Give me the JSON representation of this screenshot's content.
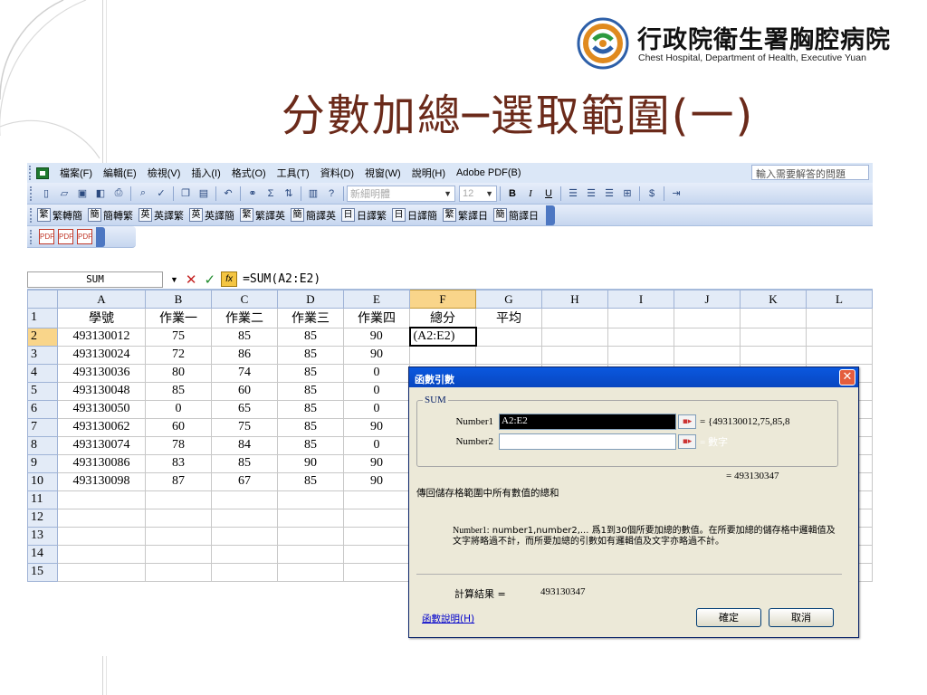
{
  "logo": {
    "name_cn": "行政院衛生署胸腔病院",
    "name_en": "Chest Hospital, Department of Health, Executive Yuan"
  },
  "slide_title": "分數加總─選取範圍(一)",
  "menu": [
    "檔案(F)",
    "編輯(E)",
    "檢視(V)",
    "插入(I)",
    "格式(O)",
    "工具(T)",
    "資料(D)",
    "視窗(W)",
    "說明(H)",
    "Adobe PDF(B)"
  ],
  "help_placeholder": "輸入需要解答的問題",
  "toolbar": {
    "font_name": "新細明體",
    "font_size": "12",
    "bold": "B",
    "italic": "I",
    "underline": "U",
    "currency": "$",
    "sigma": "Σ"
  },
  "convert_buttons": [
    {
      "icon": "繁",
      "label": "繁轉簡"
    },
    {
      "icon": "簡",
      "label": "簡轉繁"
    },
    {
      "icon": "英",
      "label": "英譯繁"
    },
    {
      "icon": "英",
      "label": "英譯簡"
    },
    {
      "icon": "繁",
      "label": "繁譯英"
    },
    {
      "icon": "簡",
      "label": "簡譯英"
    },
    {
      "icon": "日",
      "label": "日譯繁"
    },
    {
      "icon": "日",
      "label": "日譯簡"
    },
    {
      "icon": "繁",
      "label": "繁譯日"
    },
    {
      "icon": "簡",
      "label": "簡譯日"
    }
  ],
  "formula_bar": {
    "name_box": "SUM",
    "cancel": "✕",
    "enter": "✓",
    "fx": "fx",
    "formula": "=SUM(A2:E2)"
  },
  "sheet": {
    "columns": [
      "A",
      "B",
      "C",
      "D",
      "E",
      "F",
      "G",
      "H",
      "I",
      "J",
      "K",
      "L"
    ],
    "rows": [
      [
        "學號",
        "作業一",
        "作業二",
        "作業三",
        "作業四",
        "總分",
        "平均",
        "",
        "",
        "",
        "",
        ""
      ],
      [
        "493130012",
        "75",
        "85",
        "85",
        "90",
        "(A2:E2)",
        "",
        "",
        "",
        "",
        "",
        ""
      ],
      [
        "493130024",
        "72",
        "86",
        "85",
        "90",
        "",
        "",
        "",
        "",
        "",
        "",
        ""
      ],
      [
        "493130036",
        "80",
        "74",
        "85",
        "0",
        "",
        "",
        "",
        "",
        "",
        "",
        ""
      ],
      [
        "493130048",
        "85",
        "60",
        "85",
        "0",
        "",
        "",
        "",
        "",
        "",
        "",
        ""
      ],
      [
        "493130050",
        "0",
        "65",
        "85",
        "0",
        "",
        "",
        "",
        "",
        "",
        "",
        ""
      ],
      [
        "493130062",
        "60",
        "75",
        "85",
        "90",
        "",
        "",
        "",
        "",
        "",
        "",
        ""
      ],
      [
        "493130074",
        "78",
        "84",
        "85",
        "0",
        "",
        "",
        "",
        "",
        "",
        "",
        ""
      ],
      [
        "493130086",
        "83",
        "85",
        "90",
        "90",
        "",
        "",
        "",
        "",
        "",
        "",
        ""
      ],
      [
        "493130098",
        "87",
        "67",
        "85",
        "90",
        "",
        "",
        "",
        "",
        "",
        "",
        ""
      ],
      [
        "",
        "",
        "",
        "",
        "",
        "",
        "",
        "",
        "",
        "",
        "",
        ""
      ],
      [
        "",
        "",
        "",
        "",
        "",
        "",
        "",
        "",
        "",
        "",
        "",
        ""
      ],
      [
        "",
        "",
        "",
        "",
        "",
        "",
        "",
        "",
        "",
        "",
        "",
        ""
      ],
      [
        "",
        "",
        "",
        "",
        "",
        "",
        "",
        "",
        "",
        "",
        "",
        ""
      ],
      [
        "",
        "",
        "",
        "",
        "",
        "",
        "",
        "",
        "",
        "",
        "",
        ""
      ]
    ]
  },
  "dialog": {
    "title": "函數引數",
    "close": "✕",
    "func": "SUM",
    "arg1_label": "Number1",
    "arg1_value": "A2:E2",
    "arg1_result": "= {493130012,75,85,8",
    "arg2_label": "Number2",
    "arg2_value": "",
    "arg2_result": "= 數字",
    "total": "= 493130347",
    "description": "傳回儲存格範圍中所有數值的總和",
    "arg_desc_name": "Number1:",
    "arg_desc_text": "number1,number2,... 爲1到30個所要加總的數值。在所要加總的儲存格中邏輯值及文字將略過不計，而所要加總的引數如有邏輯值及文字亦略過不計。",
    "calc_label": "計算結果 =",
    "calc_value": "493130347",
    "help_link": "函數說明(H)",
    "ok": "確定",
    "cancel": "取消"
  }
}
